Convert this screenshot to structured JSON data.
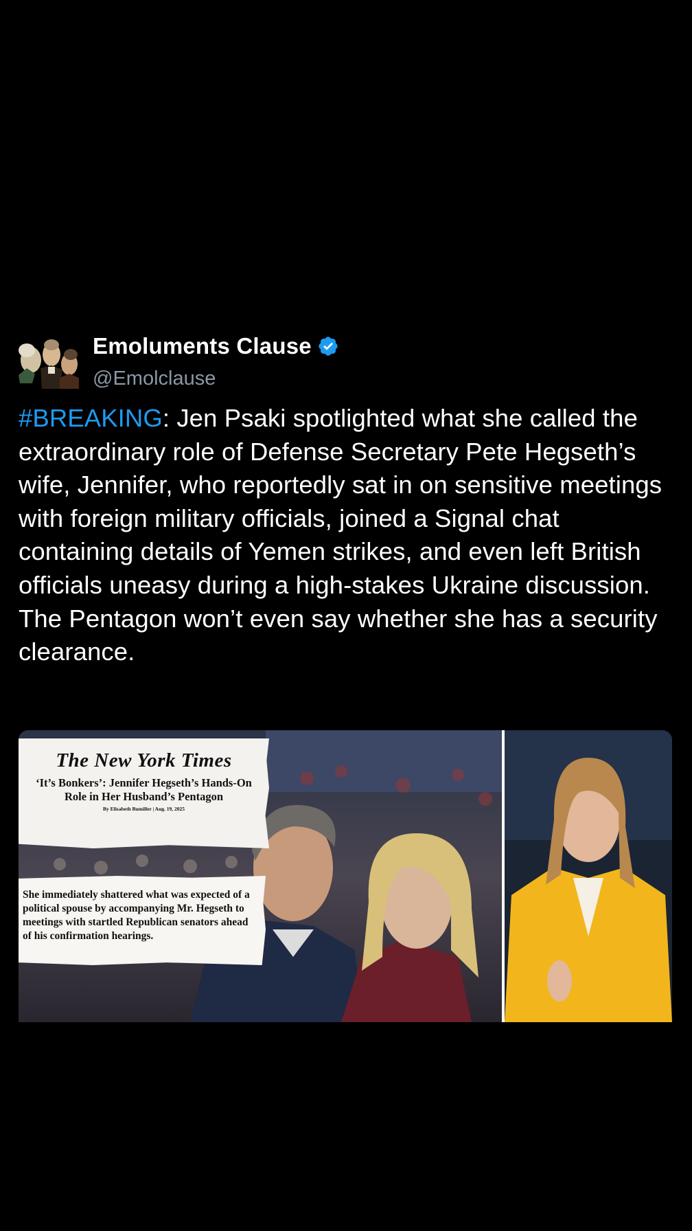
{
  "author": {
    "display_name": "Emoluments Clause",
    "handle": "@Emolclause",
    "verified": true,
    "avatar_icon": "founding-fathers-portrait-avatar"
  },
  "tweet": {
    "hashtag": "#BREAKING",
    "text": ": Jen Psaki spotlighted what she called the extraordinary role of Defense Secretary Pete Hegseth’s wife, Jennifer, who reportedly sat in on sensitive meetings with foreign military officials, joined a Signal chat containing details of Yemen strikes, and even left British officials uneasy during a high-stakes Ukraine discussion. The Pentagon won’t even say whether she has a security clearance."
  },
  "media": {
    "newspaper": "The New York Times",
    "headline": "‘It’s Bonkers’: Jennifer Hegseth’s Hands-On Role in Her Husband’s Pentagon",
    "byline": "By Elisabeth Bumiller | Aug. 19, 2025",
    "excerpt": "She immediately shattered what was expected of a political spouse by accompanying Mr. Hegseth to meetings with startled Republican senators ahead of his confirmation hearings."
  },
  "colors": {
    "background": "#000000",
    "text": "#ffffff",
    "handle": "#8b98a5",
    "accent": "#1d9bf0",
    "verified_badge": "#1d9bf0"
  }
}
